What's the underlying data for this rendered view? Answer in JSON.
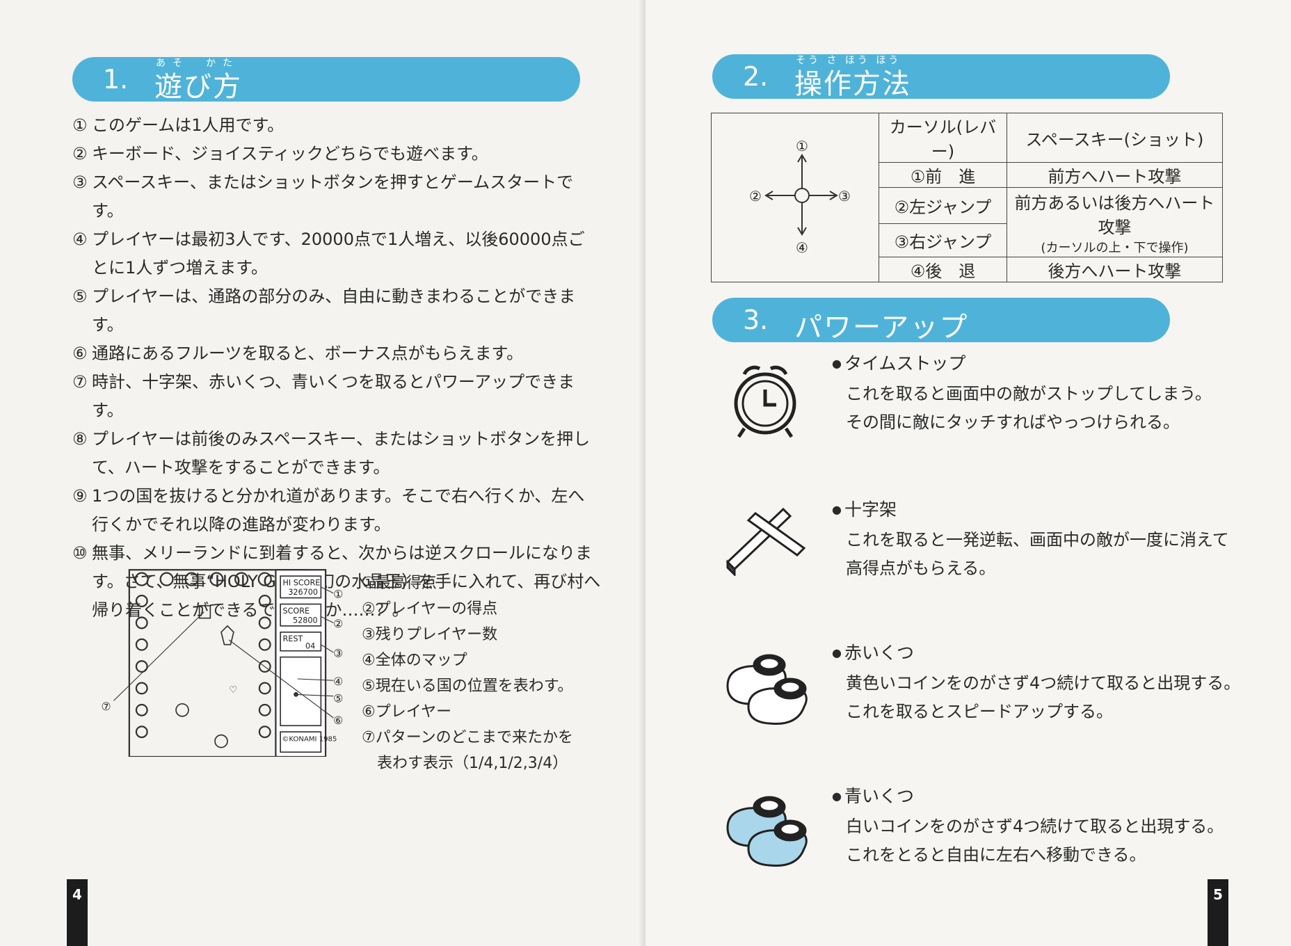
{
  "left_page": {
    "section1": {
      "number": "1.",
      "title": "遊び方",
      "ruby": "あそ　かた"
    },
    "rules": [
      {
        "mark": "①",
        "text": "このゲームは1人用です。"
      },
      {
        "mark": "②",
        "text": "キーボード、ジョイスティックどちらでも遊べます。"
      },
      {
        "mark": "③",
        "text": "スペースキー、またはショットボタンを押すとゲームスタートです。"
      },
      {
        "mark": "④",
        "text": "プレイヤーは最初3人です、20000点で1人増え、以後60000点ごとに1人ずつ増えます。"
      },
      {
        "mark": "⑤",
        "text": "プレイヤーは、通路の部分のみ、自由に動きまわることができます。"
      },
      {
        "mark": "⑥",
        "text": "通路にあるフルーツを取ると、ボーナス点がもらえます。"
      },
      {
        "mark": "⑦",
        "text": "時計、十字架、赤いくつ、青いくつを取るとパワーアップできます。"
      },
      {
        "mark": "⑧",
        "text": "プレイヤーは前後のみスペースキー、またはショットボタンを押して、ハート攻撃をすることができます。"
      },
      {
        "mark": "⑨",
        "text": "1つの国を抜けると分かれ道があります。そこで右へ行くか、左へ行くかでそれ以降の進路が変わります。"
      },
      {
        "mark": "⑩",
        "text": "無事、メリーランドに到着すると、次からは逆スクロールになります。さて、無事“HOLY GEM”（幻の水晶玉）を手に入れて、再び村へ帰り着くことができるでしょうか……？。"
      }
    ],
    "screen": {
      "hiscore_label": "HI SCORE",
      "hiscore_value": "326700",
      "score_label": "SCORE",
      "score_value": "52800",
      "rest_label": "REST",
      "rest_value": "04",
      "copyright": "©KONAMI 1985",
      "callouts": [
        "①",
        "②",
        "③",
        "④",
        "⑤",
        "⑥",
        "⑦"
      ]
    },
    "legend": [
      "①最高得点",
      "②プレイヤーの得点",
      "③残りプレイヤー数",
      "④全体のマップ",
      "⑤現在いる国の位置を表わす。",
      "⑥プレイヤー",
      "⑦パターンのどこまで来たかを",
      "表わす表示（1/4,1/2,3/4）"
    ],
    "page_number": "4"
  },
  "right_page": {
    "section2": {
      "number": "2.",
      "title": "操作方法",
      "ruby": "そう さ ほう ほう"
    },
    "controls": {
      "header_cursor": "カーソル(レバー)",
      "header_space": "スペースキー(ショット)",
      "dirs": [
        "①",
        "②",
        "③",
        "④"
      ],
      "rows": [
        {
          "cursor": "①前　進",
          "space": "前方へハート攻撃"
        },
        {
          "cursor": "②左ジャンプ",
          "space": "前方あるいは後方へハート攻撃",
          "note": "(カーソルの上・下で操作)"
        },
        {
          "cursor": "③右ジャンプ"
        },
        {
          "cursor": "④後　退",
          "space": "後方へハート攻撃"
        }
      ]
    },
    "section3": {
      "number": "3.",
      "title": "パワーアップ"
    },
    "powerups": [
      {
        "name": "タイムストップ",
        "icon": "alarm-clock-icon",
        "lines": [
          "これを取ると画面中の敵がストップしてしまう。",
          "その間に敵にタッチすればやっつけられる。"
        ]
      },
      {
        "name": "十字架",
        "icon": "cross-icon",
        "lines": [
          "これを取ると一発逆転、画面中の敵が一度に消えて",
          "高得点がもらえる。"
        ]
      },
      {
        "name": "赤いくつ",
        "icon": "red-shoes-icon",
        "lines": [
          "黄色いコインをのがさず4つ続けて取ると出現する。",
          "これを取るとスピードアップする。"
        ]
      },
      {
        "name": "青いくつ",
        "icon": "blue-shoes-icon",
        "lines": [
          "白いコインをのがさず4つ続けて取ると出現する。",
          "これをとると自由に左右へ移動できる。"
        ]
      }
    ],
    "page_number": "5"
  },
  "colors": {
    "banner": "#4fb3d9",
    "shoe_blue": "#a9d6ea",
    "ink": "#2a2a2a"
  }
}
